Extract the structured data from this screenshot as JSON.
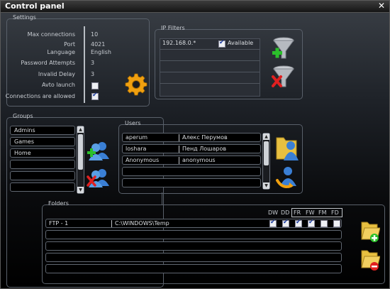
{
  "window": {
    "title": "Control panel",
    "close_glyph": "✕"
  },
  "settings": {
    "group_label": "Settings",
    "fields": [
      {
        "label": "Max connections",
        "value": "10"
      },
      {
        "label": "Port",
        "value": "4021"
      },
      {
        "label": "Language",
        "value": "English"
      },
      {
        "label": "Password Attempts",
        "value": "3"
      },
      {
        "label": "Invalid Delay",
        "value": "3"
      },
      {
        "label": "Avto launch",
        "checked": false
      },
      {
        "label": "Connections are allowed",
        "checked": true
      }
    ]
  },
  "ip_filters": {
    "group_label": "IP Filters",
    "rows": [
      {
        "ip": "192.168.0.*",
        "available_label": "Available",
        "available": true
      },
      {
        "ip": "",
        "available_label": "",
        "available": false
      },
      {
        "ip": "",
        "available_label": "",
        "available": false
      },
      {
        "ip": "",
        "available_label": "",
        "available": false
      },
      {
        "ip": "",
        "available_label": "",
        "available": false
      }
    ]
  },
  "groups": {
    "group_label": "Groups",
    "items": [
      "Admins",
      "Games",
      "Home",
      "",
      "",
      ""
    ]
  },
  "users": {
    "group_label": "Users",
    "rows": [
      {
        "login": "aperum",
        "name": "Алекс Перумов"
      },
      {
        "login": "loshara",
        "name": "Пенд Лошаров"
      },
      {
        "login": "Anonymous",
        "name": "anonymous"
      },
      {
        "login": "",
        "name": ""
      },
      {
        "login": "",
        "name": ""
      }
    ]
  },
  "folders": {
    "group_label": "Folders",
    "permission_headers": [
      "DW",
      "DD",
      "FR",
      "FW",
      "FM",
      "FD"
    ],
    "rows": [
      {
        "name": "FTP - 1",
        "path": "C:\\WINDOWS\\Temp",
        "perms": [
          true,
          true,
          true,
          true,
          false,
          false
        ]
      },
      {
        "name": "",
        "path": "",
        "perms": []
      },
      {
        "name": "",
        "path": "",
        "perms": []
      },
      {
        "name": "",
        "path": "",
        "perms": []
      },
      {
        "name": "",
        "path": "",
        "perms": []
      }
    ]
  },
  "icons": {
    "settings": "gear-icon",
    "add_filter": "funnel-add-icon",
    "remove_filter": "funnel-remove-icon",
    "add_group": "group-add-icon",
    "remove_group": "group-remove-icon",
    "add_user": "user-add-icon",
    "user_refresh": "user-refresh-icon",
    "add_folder": "folder-add-icon",
    "remove_folder": "folder-remove-icon"
  },
  "colors": {
    "accent_green": "#2bbf2b",
    "accent_red": "#e02020",
    "gear_orange": "#f0a010",
    "user_blue": "#3a7fd5",
    "folder_yellow": "#e8c040"
  }
}
